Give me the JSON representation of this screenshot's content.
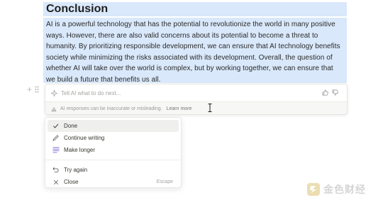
{
  "document": {
    "heading": "Conclusion",
    "paragraph": "AI is a powerful technology that has the potential to revolutionize the world in many positive ways. However, there are also valid concerns about its potential to become a threat to humanity. By prioritizing responsible development, we can ensure that AI technology benefits society while minimizing the risks associated with its development. Overall, the question of whether AI will take over the world is complex, but by working together, we can ensure that we build a future that benefits us all."
  },
  "ai_prompt": {
    "placeholder": "Tell AI what to do next...",
    "notice": "AI responses can be inaccurate or misleading.",
    "learn_more": "Learn more",
    "icons": {
      "sparkle": "sparkle-icon",
      "thumbs_up": "thumbs-up-icon",
      "thumbs_down": "thumbs-down-icon",
      "warning": "warning-icon"
    }
  },
  "menu": {
    "items": [
      {
        "label": "Done",
        "icon": "check-icon"
      },
      {
        "label": "Continue writing",
        "icon": "pen-icon"
      },
      {
        "label": "Make longer",
        "icon": "lines-icon"
      }
    ],
    "secondary_items": [
      {
        "label": "Try again",
        "icon": "undo-icon"
      },
      {
        "label": "Close",
        "icon": "close-icon",
        "shortcut": "Escape"
      }
    ]
  },
  "watermark": {
    "text": "金色财经"
  },
  "colors": {
    "selection": "#d9e8fa",
    "menu_active": "#efefed",
    "watermark_gold": "#c9a227"
  }
}
